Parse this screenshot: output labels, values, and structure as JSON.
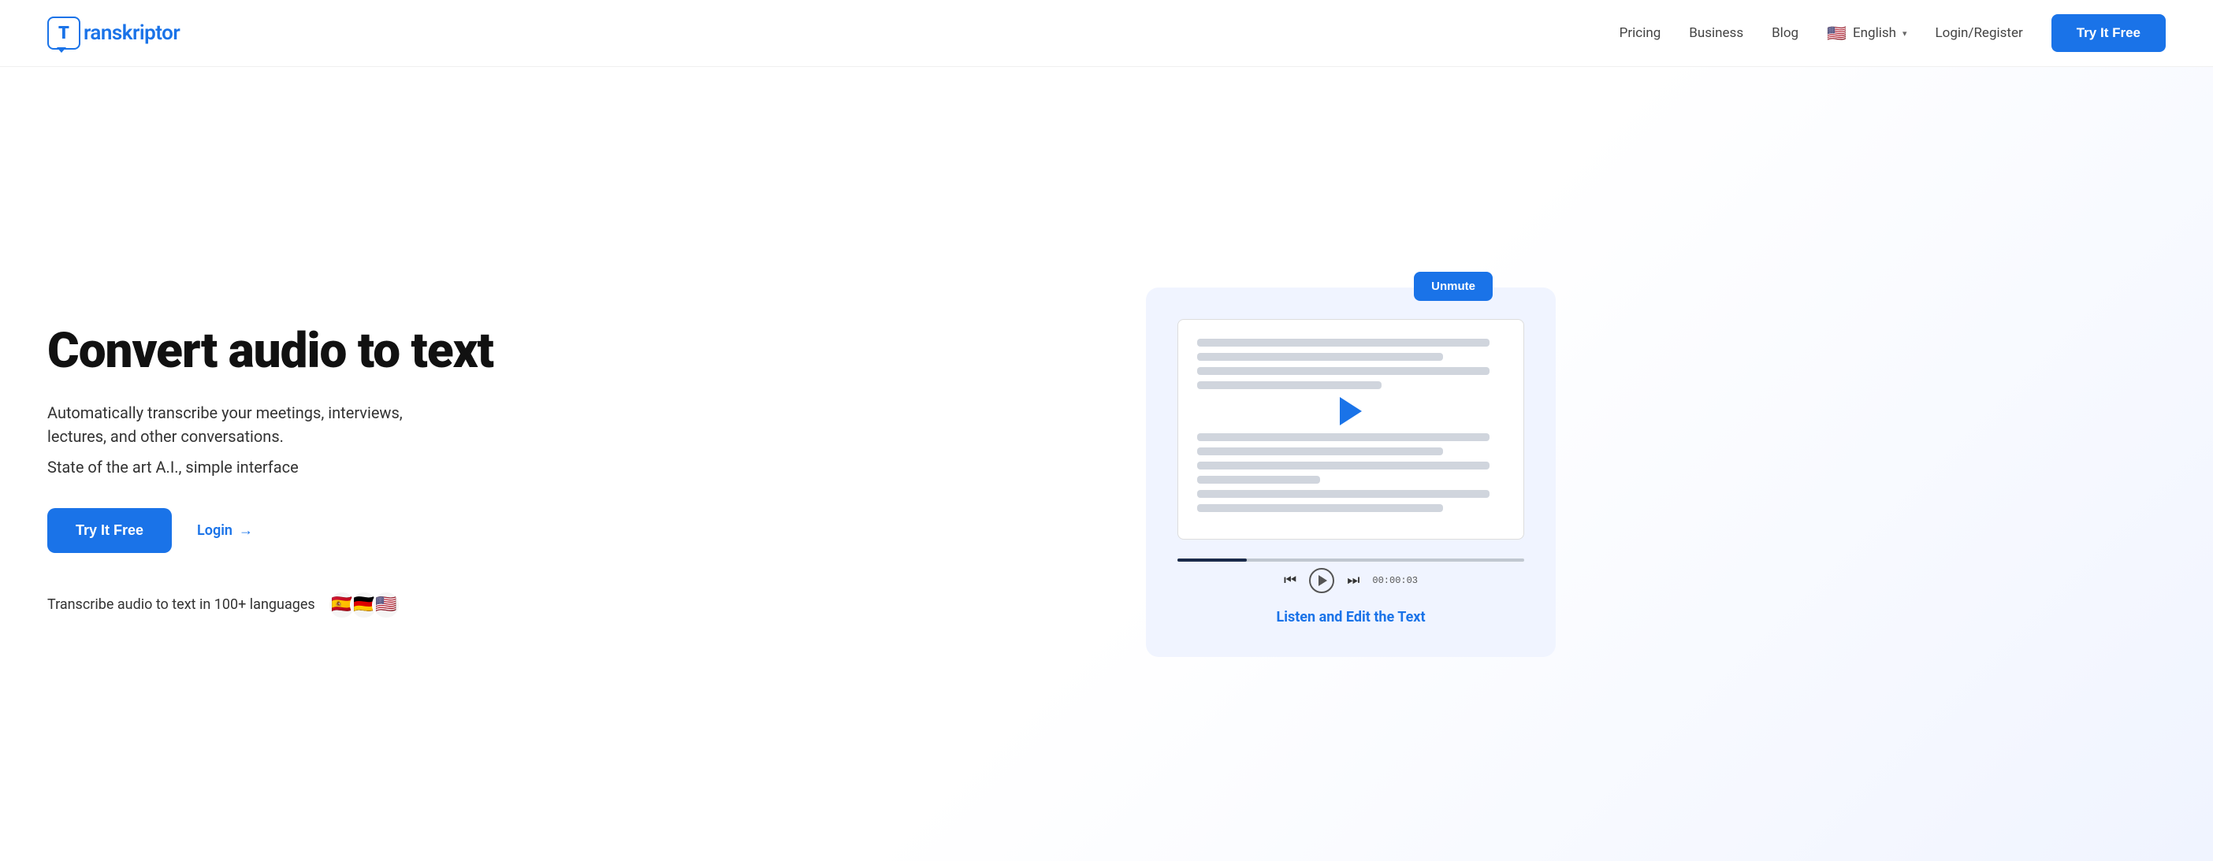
{
  "header": {
    "logo_text": "ranskriptor",
    "logo_letter": "T",
    "nav": {
      "pricing": "Pricing",
      "business": "Business",
      "blog": "Blog",
      "language": "English",
      "login_register": "Login/Register",
      "try_free": "Try It Free"
    }
  },
  "hero": {
    "title": "Convert audio to text",
    "subtitle": "Automatically transcribe your meetings, interviews, lectures, and other conversations.",
    "tagline": "State of the art A.I., simple interface",
    "try_free_btn": "Try It Free",
    "login_btn": "Login",
    "login_arrow": "→",
    "languages_text": "Transcribe audio to text in 100+ languages",
    "player": {
      "unmute_btn": "Unmute",
      "timestamp": "00:00:03",
      "listen_edit": "Listen and Edit the Text"
    }
  },
  "colors": {
    "primary": "#1a73e8",
    "text_dark": "#111111",
    "text_medium": "#333333",
    "text_light": "#666666"
  }
}
